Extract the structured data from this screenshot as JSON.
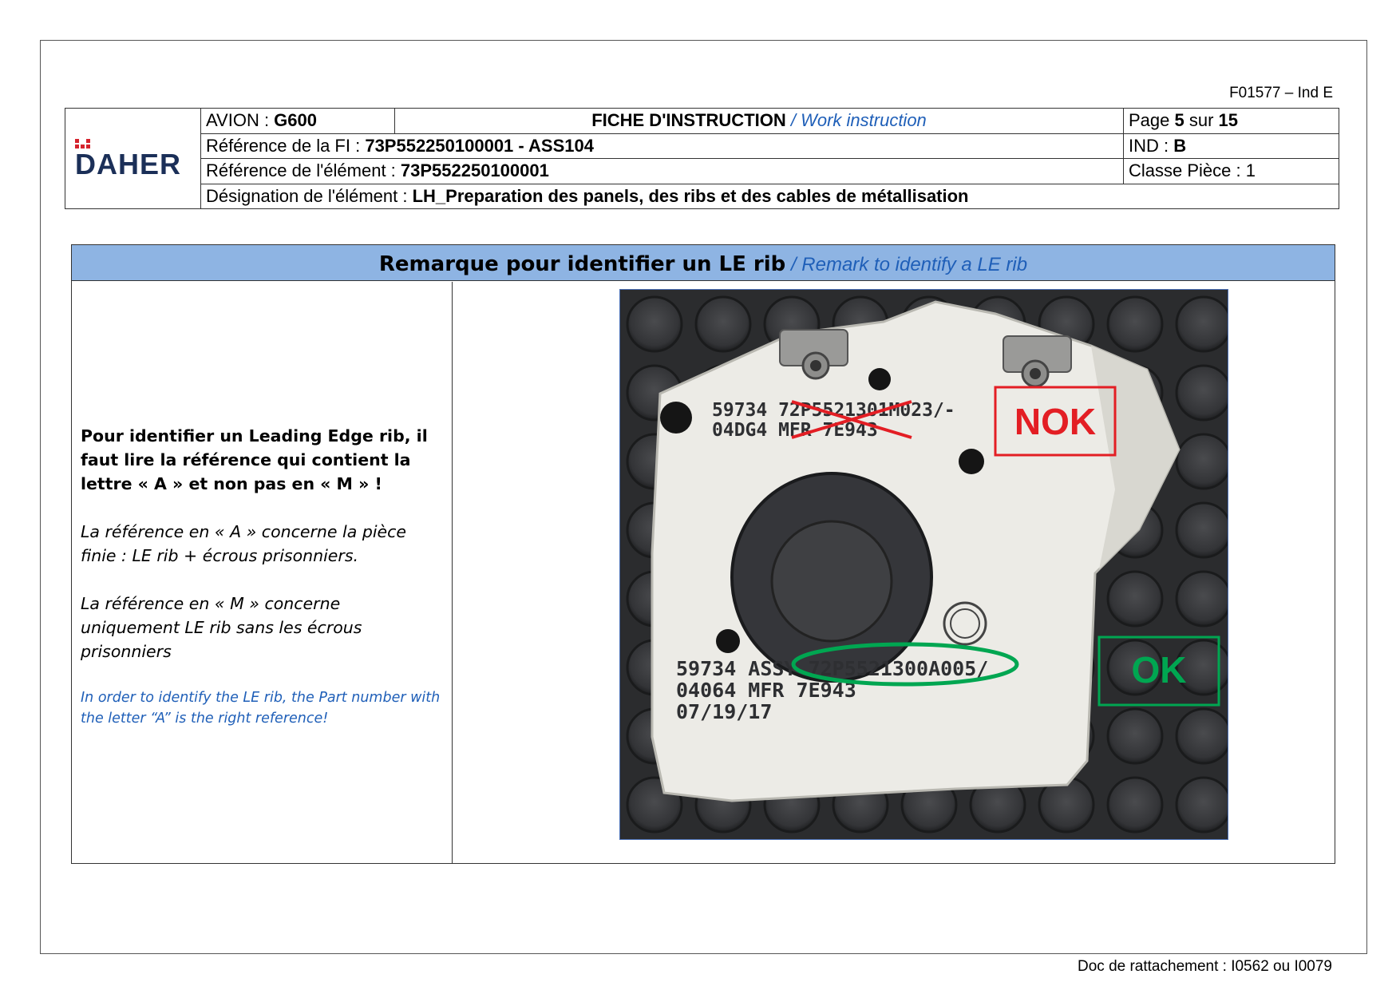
{
  "doc_code": "F01577 – Ind E",
  "logo": {
    "text": "DAHER"
  },
  "header": {
    "avion_label": "AVION : ",
    "avion_value": "G600",
    "title_fr": "FICHE D'INSTRUCTION",
    "title_en": " / Work instruction",
    "page_label": "Page ",
    "page_current": "5",
    "page_sep": " sur ",
    "page_total": "15",
    "ref_fi_label": "Référence de la FI : ",
    "ref_fi_value": "73P552250100001 - ASS104",
    "ind_label": "IND : ",
    "ind_value": "B",
    "ref_elem_label": "Référence de l'élément : ",
    "ref_elem_value": "73P552250100001",
    "classe": "Classe Pièce : 1",
    "desig_label": "Désignation de l'élément : ",
    "desig_value": "LH_Preparation des panels, des ribs et des cables de métallisation"
  },
  "remark": {
    "title_fr": "Remarque pour identifier un LE rib",
    "title_en": " / Remark to identify a LE rib",
    "para1": "Pour identifier un Leading Edge rib, il faut lire la référence qui contient la lettre « A » et non pas en « M » !",
    "para2": "La référence en « A » concerne la pièce finie : LE rib + écrous prisonniers.",
    "para3": "La référence en « M » concerne uniquement LE rib sans les écrous prisonniers",
    "para_en": "In order to identify the LE rib, the Part number with the letter “A” is the right reference!"
  },
  "photo": {
    "top_line1": "59734 72P5521301M023/-",
    "top_line2": "04DG4 MFR 7E943",
    "nok_label": "NOK",
    "bottom_line1": "59734 ASSY 72P5521300A005/",
    "bottom_line2": "04064 MFR 7E943",
    "bottom_line3": "07/19/17",
    "ok_label": "OK",
    "colors": {
      "nok": "#e31e24",
      "ok": "#00a651",
      "background": "#3a3b3d",
      "part": "#ecebe6"
    }
  },
  "footer": "Doc de rattachement : I0562 ou I0079"
}
